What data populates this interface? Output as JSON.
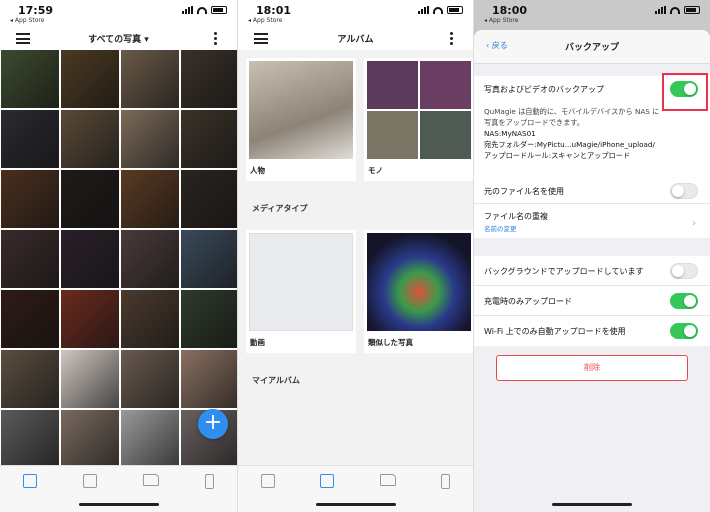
{
  "colors": {
    "accent": "#2f8ef0",
    "switch_on": "#34c759",
    "danger": "#e34b4b",
    "highlight": "#e8334a"
  },
  "panel1": {
    "time": "17:59",
    "back_label": "◂ App Store",
    "title": "すべての写真 ▾",
    "tiles": [
      "#3c4a2e",
      "#4b3a22",
      "#6a5a48",
      "#3a3028",
      "#2a2a30",
      "#5a4a38",
      "#7b6a5a",
      "#3b3228",
      "#4a2e1e",
      "#1e1a18",
      "#5a3a22",
      "#2a2420",
      "#3a2a2a",
      "#2a2028",
      "#4a3a3a",
      "#3a4a5a",
      "#2e1a14",
      "#6a2a1e",
      "#4a3a2e",
      "#2e3a2a",
      "#5a4e40",
      "#cfc6c0",
      "#6a5a50",
      "#8a7060",
      "#5a5a5a",
      "#7a6a60",
      "#9a9a9a",
      "#6a6060"
    ],
    "fab": "+",
    "tabs": [
      {
        "icon": "photos-icon",
        "active": true
      },
      {
        "icon": "albums-icon"
      },
      {
        "icon": "folder-icon"
      },
      {
        "icon": "device-icon"
      }
    ]
  },
  "panel2": {
    "time": "18:01",
    "back_label": "◂ App Store",
    "title": "アルバム",
    "albums": [
      {
        "label": "人物"
      },
      {
        "label": "モノ"
      }
    ],
    "media_type_heading": "メディアタイプ",
    "media": [
      {
        "label": "動画"
      },
      {
        "label": "類似した写真"
      }
    ],
    "my_albums_heading": "マイアルバム"
  },
  "panel3": {
    "time": "18:00",
    "back_label": "◂ App Store",
    "nav_back": "戻る",
    "title": "バックアップ",
    "backup_toggle_label": "写真およびビデオのバックアップ",
    "desc_line1": "QuMagie は自動的に、モバイルデバイスから NAS に",
    "desc_line2": "写真をアップロードできます。",
    "desc_nas": "NAS:MyNAS01",
    "desc_folder": "宛先フォルダー:MyPictu...uMagie/iPhone_upload/",
    "desc_rule": "アップロードルール:スキャンとアップロード",
    "keep_filename_label": "元のファイル名を使用",
    "duplicate_label": "ファイル名の重複",
    "duplicate_value": "名前の変更",
    "background_label": "バックグラウンドでアップロードしています",
    "charging_label": "充電時のみアップロード",
    "wifi_label": "Wi-Fi 上でのみ自動アップロードを使用",
    "delete_label": "削除",
    "toggles": {
      "backup": true,
      "keep_filename": false,
      "background": false,
      "charging": true,
      "wifi": true
    }
  }
}
